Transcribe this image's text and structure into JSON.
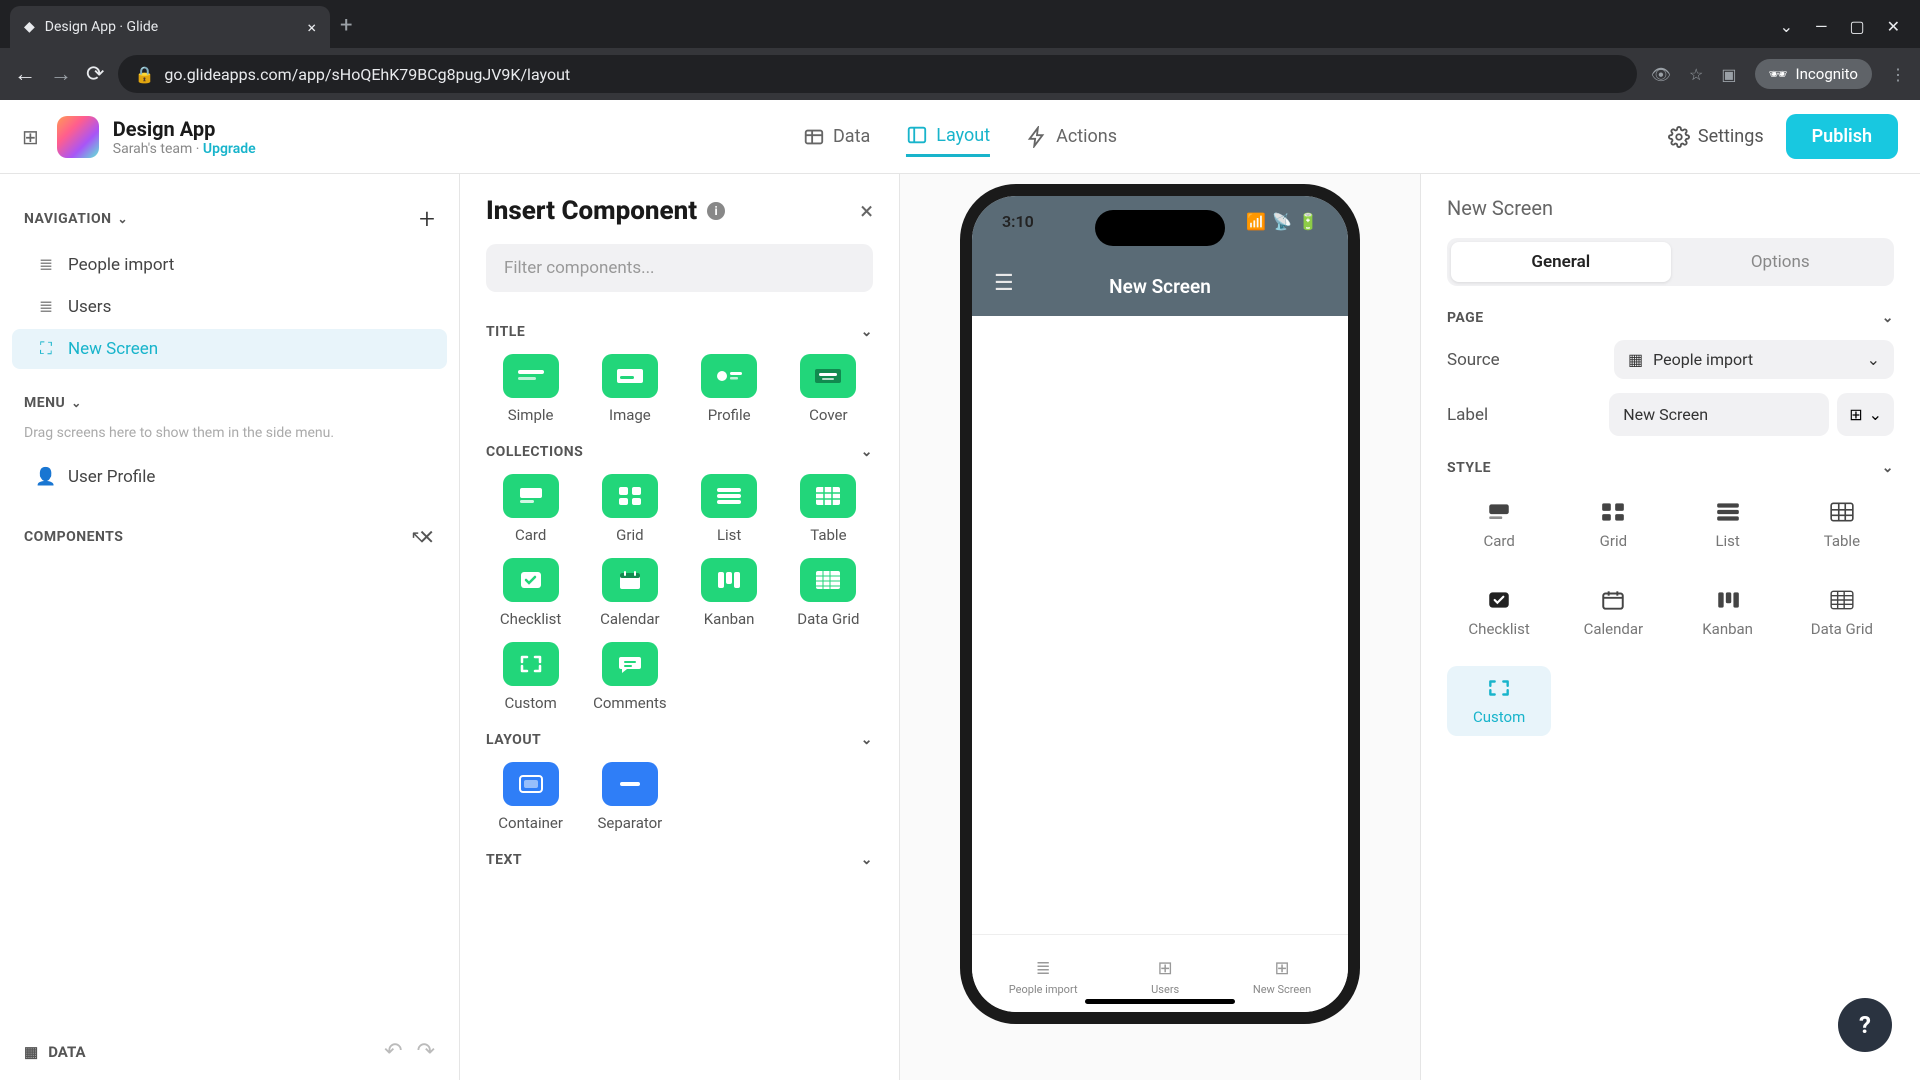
{
  "browser": {
    "tab_title": "Design App · Glide",
    "url": "go.glideapps.com/app/sHoQEhK79BCg8pugJV9K/layout",
    "incognito_label": "Incognito"
  },
  "header": {
    "app_name": "Design App",
    "team": "Sarah's team",
    "upgrade": "Upgrade",
    "tabs": {
      "data": "Data",
      "layout": "Layout",
      "actions": "Actions"
    },
    "settings": "Settings",
    "publish": "Publish"
  },
  "sidebar": {
    "navigation_label": "NAVIGATION",
    "nav_items": [
      {
        "label": "People import"
      },
      {
        "label": "Users"
      },
      {
        "label": "New Screen"
      }
    ],
    "menu_label": "MENU",
    "menu_hint": "Drag screens here to show them in the side menu.",
    "menu_items": [
      {
        "label": "User Profile"
      }
    ],
    "components_label": "COMPONENTS",
    "data_footer": "DATA"
  },
  "insert": {
    "title": "Insert Component",
    "filter_placeholder": "Filter components...",
    "sections": {
      "title": {
        "label": "TITLE",
        "items": [
          "Simple",
          "Image",
          "Profile",
          "Cover"
        ]
      },
      "collections": {
        "label": "COLLECTIONS",
        "items": [
          "Card",
          "Grid",
          "List",
          "Table",
          "Checklist",
          "Calendar",
          "Kanban",
          "Data Grid",
          "Custom",
          "Comments"
        ]
      },
      "layout": {
        "label": "LAYOUT",
        "items": [
          "Container",
          "Separator"
        ]
      },
      "text": {
        "label": "TEXT"
      }
    }
  },
  "phone": {
    "time": "3:10",
    "screen_title": "New Screen",
    "tabs": [
      "People import",
      "Users",
      "New Screen"
    ]
  },
  "right": {
    "title": "New Screen",
    "seg": {
      "general": "General",
      "options": "Options"
    },
    "page_label": "PAGE",
    "source_label": "Source",
    "source_value": "People import",
    "label_label": "Label",
    "label_value": "New Screen",
    "style_label": "STYLE",
    "styles": [
      "Card",
      "Grid",
      "List",
      "Table",
      "Checklist",
      "Calendar",
      "Kanban",
      "Data Grid",
      "Custom"
    ]
  }
}
